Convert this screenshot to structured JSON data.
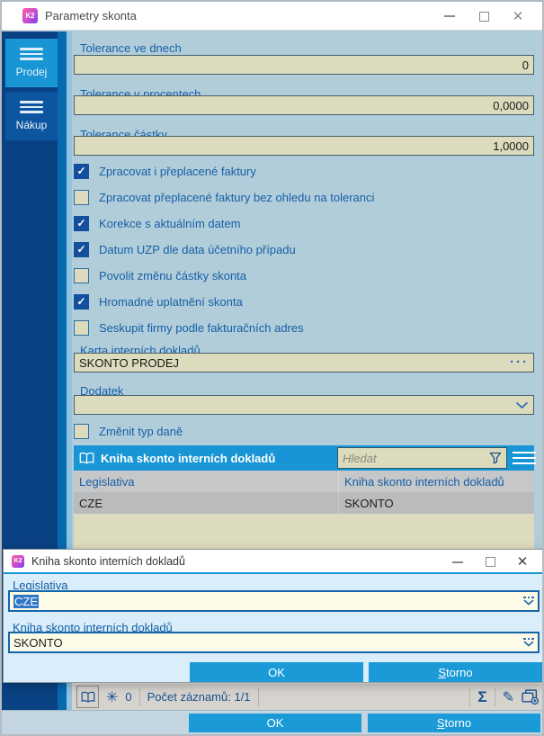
{
  "window": {
    "title": "Parametry skonta",
    "app_icon": "K2",
    "controls": {
      "minimize": "minimize",
      "maximize": "maximize",
      "close": "close"
    }
  },
  "sidebar": {
    "tabs": [
      {
        "label": "Prodej",
        "active": true
      },
      {
        "label": "Nákup",
        "active": false
      }
    ]
  },
  "fields": {
    "tolerance_days": {
      "label": "Tolerance ve dnech",
      "value": "0"
    },
    "tolerance_percent": {
      "label": "Tolerance v procentech",
      "value": "0,0000"
    },
    "tolerance_amount": {
      "label": "Tolerance částky",
      "value": "1,0000"
    },
    "internal_card": {
      "label": "Karta interních dokladů",
      "value": "SKONTO PRODEJ"
    },
    "addendum": {
      "label": "Dodatek",
      "value": ""
    }
  },
  "checkboxes": [
    {
      "label": "Zpracovat i přeplacené faktury",
      "checked": true
    },
    {
      "label": "Zpracovat přeplacené faktury bez ohledu na toleranci",
      "checked": false
    },
    {
      "label": "Korekce s aktuálním datem",
      "checked": true
    },
    {
      "label": "Datum UZP dle data účetního případu",
      "checked": true
    },
    {
      "label": "Povolit změnu částky skonta",
      "checked": false
    },
    {
      "label": "Hromadné uplatnění skonta",
      "checked": true
    },
    {
      "label": "Seskupit firmy podle fakturačních adres",
      "checked": false
    }
  ],
  "change_tax_checkbox": {
    "label": "Změnit typ daně",
    "checked": false
  },
  "table": {
    "title": "Kniha skonto interních dokladů",
    "search_placeholder": "Hledat",
    "columns": [
      "Legislativa",
      "Kniha skonto interních dokladů"
    ],
    "rows": [
      [
        "CZE",
        "SKONTO"
      ]
    ]
  },
  "dialog": {
    "title": "Kniha skonto interních dokladů",
    "fields": [
      {
        "label": "Legislativa",
        "value": "CZE"
      },
      {
        "label": "Kniha skonto interních dokladů",
        "value": "SKONTO"
      }
    ],
    "buttons": {
      "ok": "OK",
      "cancel": "Storno"
    }
  },
  "statusbar": {
    "star_count": "0",
    "records": "Počet záznamů: 1/1"
  },
  "footer": {
    "ok": "OK",
    "cancel": "Storno"
  },
  "colors": {
    "accent_blue": "#1795d4",
    "navy": "#0a4183",
    "tab_inactive": "#0e55a0",
    "content_bg": "#b2cdda",
    "input_beige": "#dcdbbd",
    "dialog_bg": "#d9edfa",
    "dialog_input": "#fdfbe7",
    "label_blue": "#155fa6",
    "selection_blue": "#2e77c8",
    "button_blue": "#1b9ad8"
  }
}
